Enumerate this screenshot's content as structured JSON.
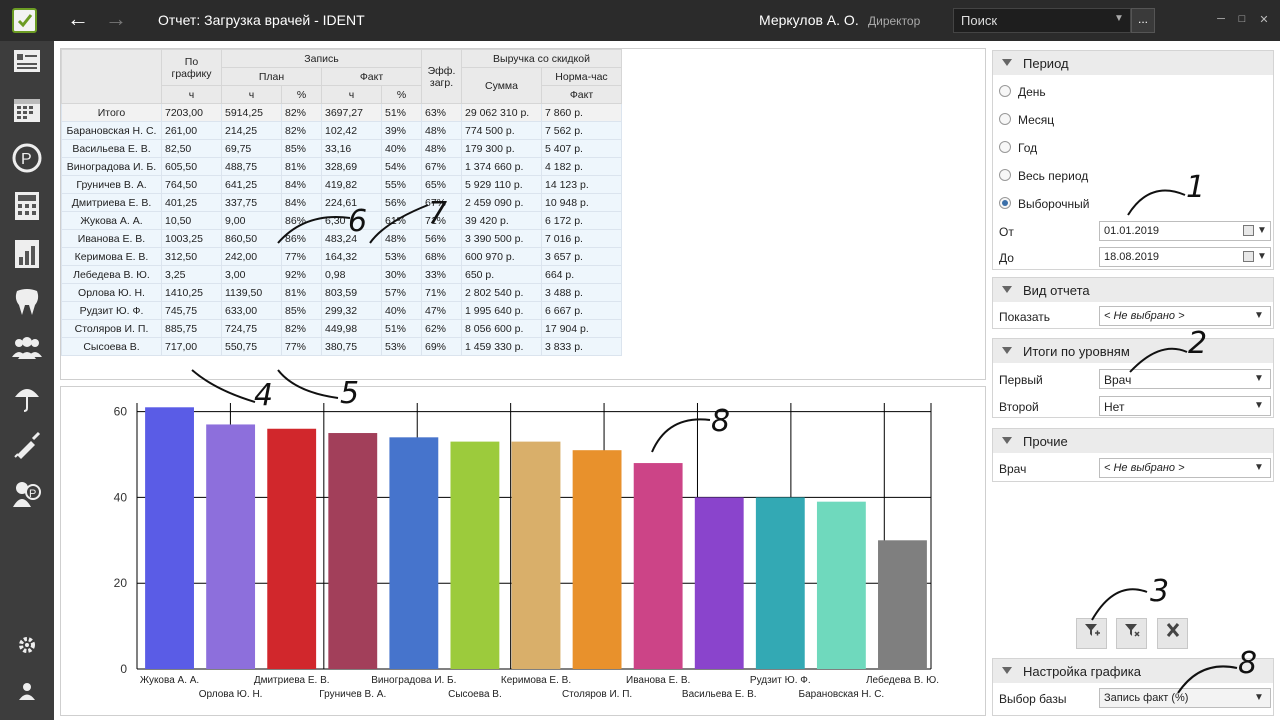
{
  "app": {
    "title": "Отчет: Загрузка врачей - IDENT",
    "user": "Меркулов А. О.",
    "role": "Директор",
    "search_label": "Поиск",
    "search_btn": "..."
  },
  "table": {
    "headers": {
      "by_schedule": "По графику",
      "record": "Запись",
      "plan": "План",
      "fact": "Факт",
      "eff": "Эфф. загр.",
      "revenue": "Выручка со скидкой",
      "sum": "Сумма",
      "norm_hour": "Норма-час",
      "fact2": "Факт",
      "h": "ч",
      "pct": "%"
    },
    "rows": [
      [
        "Итого",
        "7203,00",
        "5914,25",
        "82%",
        "3697,27",
        "51%",
        "63%",
        "29 062 310 р.",
        "7 860 р."
      ],
      [
        "Барановская Н. С.",
        "261,00",
        "214,25",
        "82%",
        "102,42",
        "39%",
        "48%",
        "774 500 р.",
        "7 562 р."
      ],
      [
        "Васильева Е. В.",
        "82,50",
        "69,75",
        "85%",
        "33,16",
        "40%",
        "48%",
        "179 300 р.",
        "5 407 р."
      ],
      [
        "Виноградова И. Б.",
        "605,50",
        "488,75",
        "81%",
        "328,69",
        "54%",
        "67%",
        "1 374 660 р.",
        "4 182 р."
      ],
      [
        "Груничев В. А.",
        "764,50",
        "641,25",
        "84%",
        "419,82",
        "55%",
        "65%",
        "5 929 110 р.",
        "14 123 р."
      ],
      [
        "Дмитриева Е. В.",
        "401,25",
        "337,75",
        "84%",
        "224,61",
        "56%",
        "67%",
        "2 459 090 р.",
        "10 948 р."
      ],
      [
        "Жукова А. А.",
        "10,50",
        "9,00",
        "86%",
        "6,30",
        "61%",
        "71%",
        "39 420 р.",
        "6 172 р."
      ],
      [
        "Иванова Е. В.",
        "1003,25",
        "860,50",
        "86%",
        "483,24",
        "48%",
        "56%",
        "3 390 500 р.",
        "7 016 р."
      ],
      [
        "Керимова Е. В.",
        "312,50",
        "242,00",
        "77%",
        "164,32",
        "53%",
        "68%",
        "600 970 р.",
        "3 657 р."
      ],
      [
        "Лебедева В. Ю.",
        "3,25",
        "3,00",
        "92%",
        "0,98",
        "30%",
        "33%",
        "650 р.",
        "664 р."
      ],
      [
        "Орлова Ю. Н.",
        "1410,25",
        "1139,50",
        "81%",
        "803,59",
        "57%",
        "71%",
        "2 802 540 р.",
        "3 488 р."
      ],
      [
        "Рудзит Ю. Ф.",
        "745,75",
        "633,00",
        "85%",
        "299,32",
        "40%",
        "47%",
        "1 995 640 р.",
        "6 667 р."
      ],
      [
        "Столяров И. П.",
        "885,75",
        "724,75",
        "82%",
        "449,98",
        "51%",
        "62%",
        "8 056 600 р.",
        "17 904 р."
      ],
      [
        "Сысоева В.",
        "717,00",
        "550,75",
        "77%",
        "380,75",
        "53%",
        "69%",
        "1 459 330 р.",
        "3 833 р."
      ]
    ]
  },
  "chart_data": {
    "type": "bar",
    "categories": [
      "Жукова А. А.",
      "Орлова Ю. Н.",
      "Дмитриева Е. В.",
      "Груничев В. А.",
      "Виноградова И. Б.",
      "Сысоева В.",
      "Керимова Е. В.",
      "Столяров И. П.",
      "Иванова Е. В.",
      "Васильева Е. В.",
      "Рудзит Ю. Ф.",
      "Барановская Н. С.",
      "Лебедева В. Ю."
    ],
    "values": [
      61,
      57,
      56,
      55,
      54,
      53,
      53,
      51,
      48,
      40,
      40,
      39,
      30
    ],
    "colors": [
      "#5a5ce6",
      "#8d6fdc",
      "#d1272c",
      "#a23f5a",
      "#4674cc",
      "#9ccb3c",
      "#d9af6a",
      "#e8912c",
      "#cc4487",
      "#8a44cc",
      "#33a9b4",
      "#6fd9bd",
      "#7f7f7f"
    ],
    "yticks": [
      0,
      20,
      40,
      60
    ],
    "ylim": [
      0,
      62
    ],
    "grid": true
  },
  "right": {
    "period": {
      "title": "Период",
      "options": [
        "День",
        "Месяц",
        "Год",
        "Весь период",
        "Выборочный"
      ],
      "selected": 4,
      "from_label": "От",
      "from": "01.01.2019",
      "to_label": "До",
      "to": "18.08.2019"
    },
    "report_view": {
      "title": "Вид отчета",
      "show_label": "Показать",
      "show_value": "< Не выбрано >"
    },
    "levels": {
      "title": "Итоги по уровням",
      "first_label": "Первый",
      "first_value": "Врач",
      "second_label": "Второй",
      "second_value": "Нет"
    },
    "other": {
      "title": "Прочие",
      "doctor_label": "Врач",
      "doctor_value": "< Не выбрано >"
    },
    "chart_settings": {
      "title": "Настройка графика",
      "base_label": "Выбор базы",
      "base_value": "Запись факт (%)"
    }
  },
  "annotations": [
    "1",
    "2",
    "3",
    "4",
    "5",
    "6",
    "7",
    "8",
    "8"
  ]
}
